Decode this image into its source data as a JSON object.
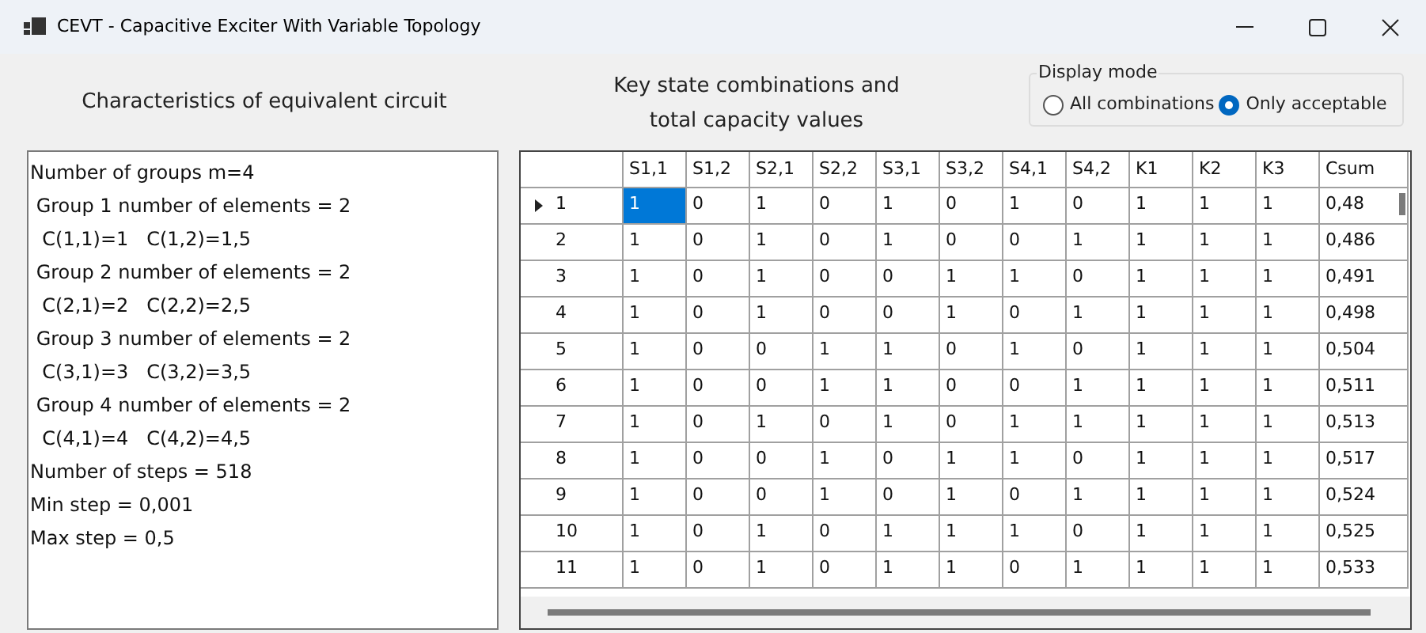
{
  "window": {
    "title": "CEVT - Capacitive Exciter With Variable Topology"
  },
  "left_heading": "Characteristics of equivalent circuit",
  "info_lines": [
    "Number of groups m=4",
    " Group 1 number of elements = 2",
    "  C(1,1)=1   C(1,2)=1,5",
    " Group 2 number of elements = 2",
    "  C(2,1)=2   C(2,2)=2,5",
    " Group 3 number of elements = 2",
    "  C(3,1)=3   C(3,2)=3,5",
    " Group 4 number of elements = 2",
    "  C(4,1)=4   C(4,2)=4,5",
    "Number of steps = 518",
    "Min step = 0,001",
    "Max step = 0,5"
  ],
  "right_heading": [
    "Key state combinations and",
    "total capacity values"
  ],
  "display_mode": {
    "label": "Display mode",
    "options": [
      {
        "label": "All combinations",
        "selected": false
      },
      {
        "label": "Only acceptable",
        "selected": true
      }
    ]
  },
  "table": {
    "columns": [
      "S1,1",
      "S1,2",
      "S2,1",
      "S2,2",
      "S3,1",
      "S3,2",
      "S4,1",
      "S4,2",
      "K1",
      "K2",
      "K3",
      "Csum"
    ],
    "rows": [
      {
        "header": "1",
        "current": true,
        "cells": [
          {
            "text": "1",
            "selected": true
          },
          {
            "text": "0",
            "selected": false
          },
          {
            "text": "1",
            "selected": false
          },
          {
            "text": "0",
            "selected": false
          },
          {
            "text": "1",
            "selected": false
          },
          {
            "text": "0",
            "selected": false
          },
          {
            "text": "1",
            "selected": false
          },
          {
            "text": "0",
            "selected": false
          },
          {
            "text": "1",
            "selected": false
          },
          {
            "text": "1",
            "selected": false
          },
          {
            "text": "1",
            "selected": false
          },
          {
            "text": "0,48",
            "selected": false
          }
        ]
      },
      {
        "header": "2",
        "current": false,
        "cells": [
          {
            "text": "1",
            "selected": false
          },
          {
            "text": "0",
            "selected": false
          },
          {
            "text": "1",
            "selected": false
          },
          {
            "text": "0",
            "selected": false
          },
          {
            "text": "1",
            "selected": false
          },
          {
            "text": "0",
            "selected": false
          },
          {
            "text": "0",
            "selected": false
          },
          {
            "text": "1",
            "selected": false
          },
          {
            "text": "1",
            "selected": false
          },
          {
            "text": "1",
            "selected": false
          },
          {
            "text": "1",
            "selected": false
          },
          {
            "text": "0,486",
            "selected": false
          }
        ]
      },
      {
        "header": "3",
        "current": false,
        "cells": [
          {
            "text": "1",
            "selected": false
          },
          {
            "text": "0",
            "selected": false
          },
          {
            "text": "1",
            "selected": false
          },
          {
            "text": "0",
            "selected": false
          },
          {
            "text": "0",
            "selected": false
          },
          {
            "text": "1",
            "selected": false
          },
          {
            "text": "1",
            "selected": false
          },
          {
            "text": "0",
            "selected": false
          },
          {
            "text": "1",
            "selected": false
          },
          {
            "text": "1",
            "selected": false
          },
          {
            "text": "1",
            "selected": false
          },
          {
            "text": "0,491",
            "selected": false
          }
        ]
      },
      {
        "header": "4",
        "current": false,
        "cells": [
          {
            "text": "1",
            "selected": false
          },
          {
            "text": "0",
            "selected": false
          },
          {
            "text": "1",
            "selected": false
          },
          {
            "text": "0",
            "selected": false
          },
          {
            "text": "0",
            "selected": false
          },
          {
            "text": "1",
            "selected": false
          },
          {
            "text": "0",
            "selected": false
          },
          {
            "text": "1",
            "selected": false
          },
          {
            "text": "1",
            "selected": false
          },
          {
            "text": "1",
            "selected": false
          },
          {
            "text": "1",
            "selected": false
          },
          {
            "text": "0,498",
            "selected": false
          }
        ]
      },
      {
        "header": "5",
        "current": false,
        "cells": [
          {
            "text": "1",
            "selected": false
          },
          {
            "text": "0",
            "selected": false
          },
          {
            "text": "0",
            "selected": false
          },
          {
            "text": "1",
            "selected": false
          },
          {
            "text": "1",
            "selected": false
          },
          {
            "text": "0",
            "selected": false
          },
          {
            "text": "1",
            "selected": false
          },
          {
            "text": "0",
            "selected": false
          },
          {
            "text": "1",
            "selected": false
          },
          {
            "text": "1",
            "selected": false
          },
          {
            "text": "1",
            "selected": false
          },
          {
            "text": "0,504",
            "selected": false
          }
        ]
      },
      {
        "header": "6",
        "current": false,
        "cells": [
          {
            "text": "1",
            "selected": false
          },
          {
            "text": "0",
            "selected": false
          },
          {
            "text": "0",
            "selected": false
          },
          {
            "text": "1",
            "selected": false
          },
          {
            "text": "1",
            "selected": false
          },
          {
            "text": "0",
            "selected": false
          },
          {
            "text": "0",
            "selected": false
          },
          {
            "text": "1",
            "selected": false
          },
          {
            "text": "1",
            "selected": false
          },
          {
            "text": "1",
            "selected": false
          },
          {
            "text": "1",
            "selected": false
          },
          {
            "text": "0,511",
            "selected": false
          }
        ]
      },
      {
        "header": "7",
        "current": false,
        "cells": [
          {
            "text": "1",
            "selected": false
          },
          {
            "text": "0",
            "selected": false
          },
          {
            "text": "1",
            "selected": false
          },
          {
            "text": "0",
            "selected": false
          },
          {
            "text": "1",
            "selected": false
          },
          {
            "text": "0",
            "selected": false
          },
          {
            "text": "1",
            "selected": false
          },
          {
            "text": "1",
            "selected": false
          },
          {
            "text": "1",
            "selected": false
          },
          {
            "text": "1",
            "selected": false
          },
          {
            "text": "1",
            "selected": false
          },
          {
            "text": "0,513",
            "selected": false
          }
        ]
      },
      {
        "header": "8",
        "current": false,
        "cells": [
          {
            "text": "1",
            "selected": false
          },
          {
            "text": "0",
            "selected": false
          },
          {
            "text": "0",
            "selected": false
          },
          {
            "text": "1",
            "selected": false
          },
          {
            "text": "0",
            "selected": false
          },
          {
            "text": "1",
            "selected": false
          },
          {
            "text": "1",
            "selected": false
          },
          {
            "text": "0",
            "selected": false
          },
          {
            "text": "1",
            "selected": false
          },
          {
            "text": "1",
            "selected": false
          },
          {
            "text": "1",
            "selected": false
          },
          {
            "text": "0,517",
            "selected": false
          }
        ]
      },
      {
        "header": "9",
        "current": false,
        "cells": [
          {
            "text": "1",
            "selected": false
          },
          {
            "text": "0",
            "selected": false
          },
          {
            "text": "0",
            "selected": false
          },
          {
            "text": "1",
            "selected": false
          },
          {
            "text": "0",
            "selected": false
          },
          {
            "text": "1",
            "selected": false
          },
          {
            "text": "0",
            "selected": false
          },
          {
            "text": "1",
            "selected": false
          },
          {
            "text": "1",
            "selected": false
          },
          {
            "text": "1",
            "selected": false
          },
          {
            "text": "1",
            "selected": false
          },
          {
            "text": "0,524",
            "selected": false
          }
        ]
      },
      {
        "header": "10",
        "current": false,
        "cells": [
          {
            "text": "1",
            "selected": false
          },
          {
            "text": "0",
            "selected": false
          },
          {
            "text": "1",
            "selected": false
          },
          {
            "text": "0",
            "selected": false
          },
          {
            "text": "1",
            "selected": false
          },
          {
            "text": "1",
            "selected": false
          },
          {
            "text": "1",
            "selected": false
          },
          {
            "text": "0",
            "selected": false
          },
          {
            "text": "1",
            "selected": false
          },
          {
            "text": "1",
            "selected": false
          },
          {
            "text": "1",
            "selected": false
          },
          {
            "text": "0,525",
            "selected": false
          }
        ]
      },
      {
        "header": "11",
        "current": false,
        "cells": [
          {
            "text": "1",
            "selected": false
          },
          {
            "text": "0",
            "selected": false
          },
          {
            "text": "1",
            "selected": false
          },
          {
            "text": "0",
            "selected": false
          },
          {
            "text": "1",
            "selected": false
          },
          {
            "text": "1",
            "selected": false
          },
          {
            "text": "0",
            "selected": false
          },
          {
            "text": "1",
            "selected": false
          },
          {
            "text": "1",
            "selected": false
          },
          {
            "text": "1",
            "selected": false
          },
          {
            "text": "1",
            "selected": false
          },
          {
            "text": "0,533",
            "selected": false
          }
        ]
      }
    ]
  }
}
